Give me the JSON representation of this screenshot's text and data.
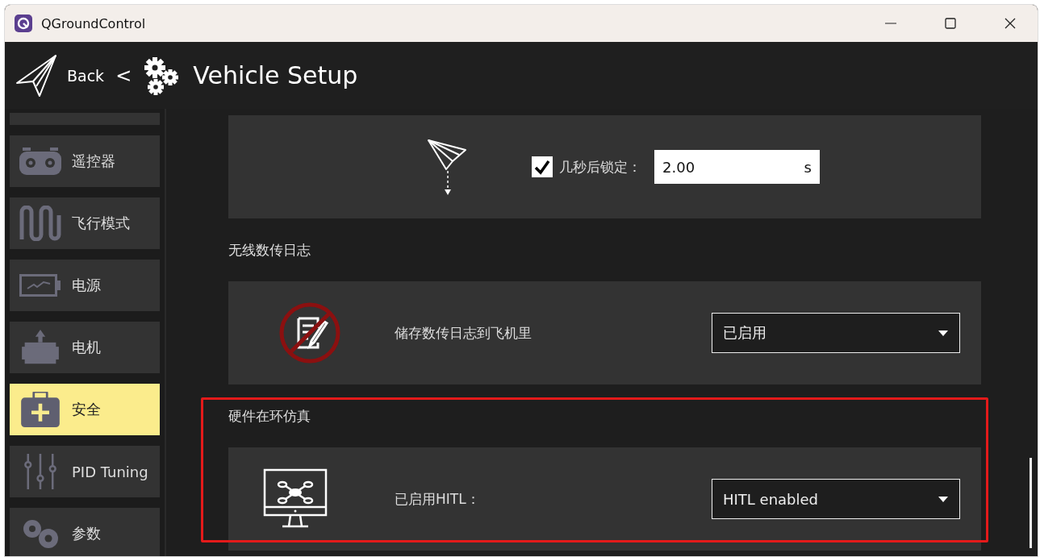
{
  "window": {
    "title": "QGroundControl"
  },
  "header": {
    "back": "Back",
    "separator": "<",
    "title": "Vehicle Setup"
  },
  "sidebar": {
    "items": [
      {
        "label": "遥控器",
        "selected": false
      },
      {
        "label": "飞行模式",
        "selected": false
      },
      {
        "label": "电源",
        "selected": false
      },
      {
        "label": "电机",
        "selected": false
      },
      {
        "label": "安全",
        "selected": true
      },
      {
        "label": "PID Tuning",
        "selected": false
      },
      {
        "label": "参数",
        "selected": false
      }
    ]
  },
  "sections": [
    {
      "row": {
        "kind": "checkbox-field",
        "checked": true,
        "label": "几秒后锁定：",
        "value": "2.00",
        "unit": "s"
      }
    },
    {
      "title": "无线数传日志",
      "row": {
        "kind": "dropdown",
        "label": "储存数传日志到飞机里",
        "value": "已启用"
      }
    },
    {
      "title": "硬件在环仿真",
      "highlighted": true,
      "row": {
        "kind": "dropdown",
        "label": "已启用HITL：",
        "value": "HITL enabled"
      }
    }
  ]
}
